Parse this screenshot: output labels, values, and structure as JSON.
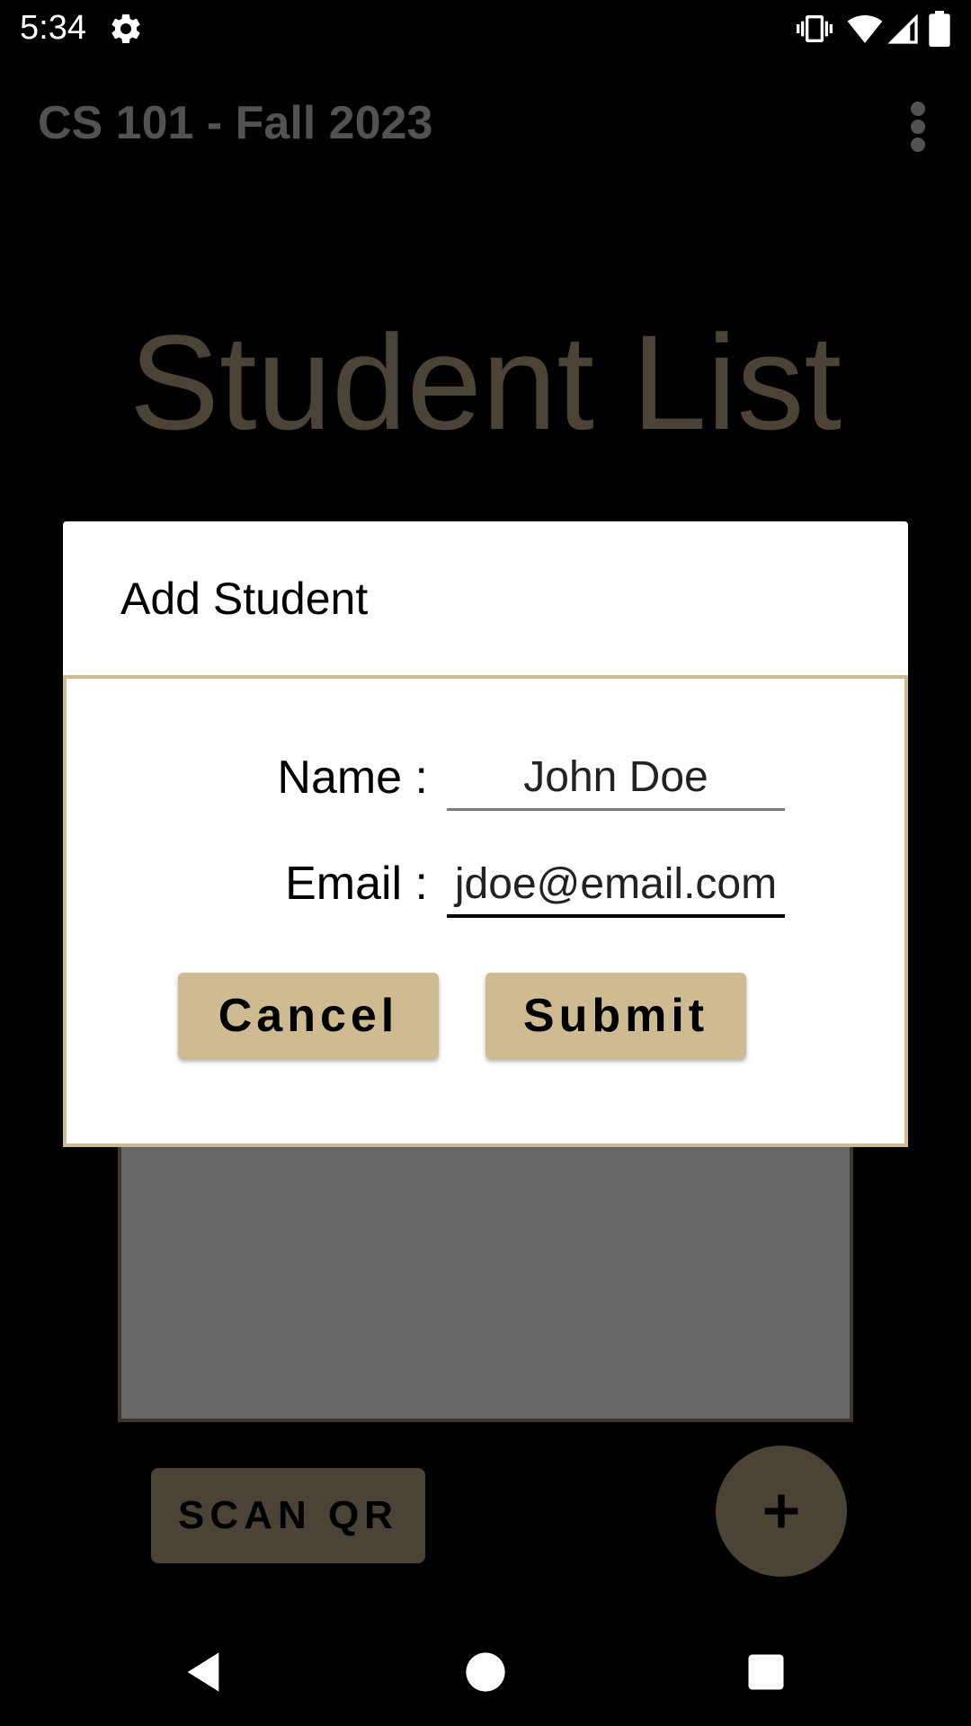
{
  "status_bar": {
    "time": "5:34",
    "icons": [
      "settings-icon",
      "vibrate-icon",
      "wifi-icon",
      "cell-signal-icon",
      "battery-icon"
    ]
  },
  "app_bar": {
    "title": "CS 101 - Fall 2023",
    "menu_icon": "more-vert-icon"
  },
  "page": {
    "heading": "Student List"
  },
  "actions": {
    "scan_label": "SCAN QR",
    "fab_icon": "plus-icon"
  },
  "dialog": {
    "title": "Add Student",
    "name_label": "Name :",
    "name_value": "John Doe",
    "email_label": "Email :",
    "email_value": "jdoe@email.com",
    "cancel_label": "Cancel",
    "submit_label": "Submit"
  },
  "nav_bar": {
    "icons": [
      "back-icon",
      "home-icon",
      "recents-icon"
    ]
  },
  "colors": {
    "accent": "#cfbb92",
    "dimmed_accent": "#4b4336",
    "background": "#000000",
    "dialog_background": "#ffffff"
  }
}
